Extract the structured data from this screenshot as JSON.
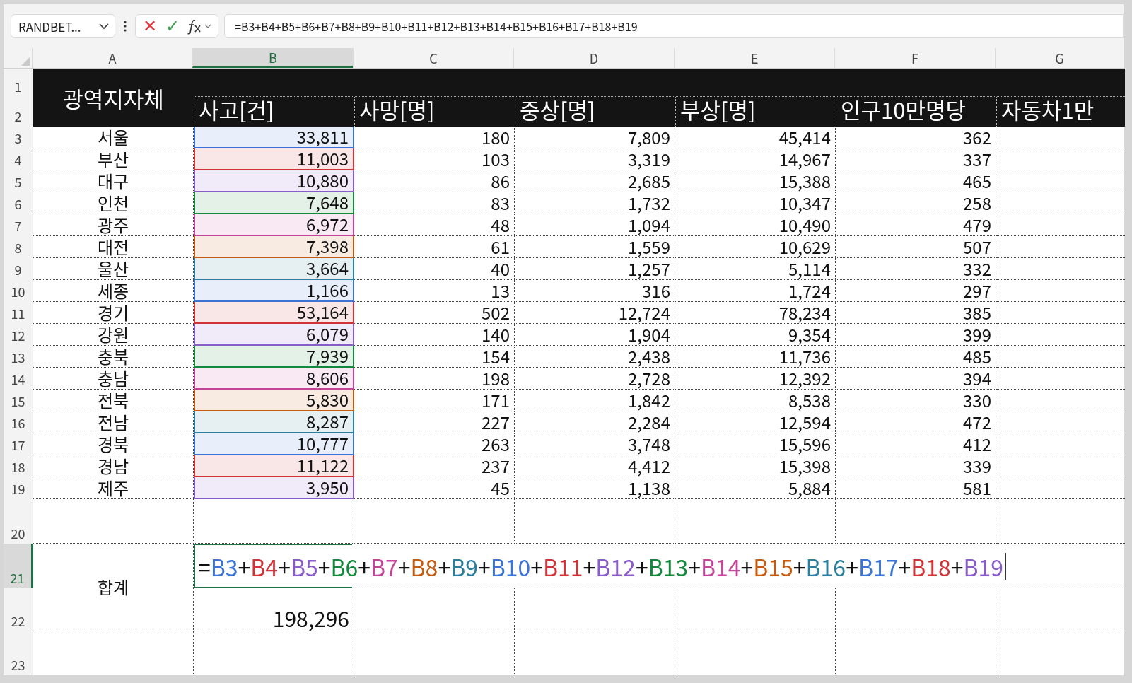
{
  "name_box": {
    "value": "RANDBET..."
  },
  "formula_bar": {
    "cancel_symbol": "✕",
    "enter_symbol": "✓",
    "value": "=B3+B4+B5+B6+B7+B8+B9+B10+B11+B12+B13+B14+B15+B16+B17+B18+B19"
  },
  "column_headers": [
    {
      "label": "A",
      "selected": false
    },
    {
      "label": "B",
      "selected": true
    },
    {
      "label": "C",
      "selected": false
    },
    {
      "label": "D",
      "selected": false
    },
    {
      "label": "E",
      "selected": false
    },
    {
      "label": "F",
      "selected": false
    },
    {
      "label": "G",
      "selected": false
    }
  ],
  "header": {
    "row_headers": [
      {
        "label": "1",
        "selected": false
      },
      {
        "label": "2",
        "selected": false
      }
    ],
    "region_label": "광역지자체",
    "columns": [
      "사고[건]",
      "사망[명]",
      "중상[명]",
      "부상[명]",
      "인구10만명당",
      "자동차1만"
    ]
  },
  "rows": [
    {
      "row_header": {
        "label": "3",
        "selected": false
      },
      "region": "서울",
      "accidents": "33,811",
      "deaths": "180",
      "serious": "7,809",
      "injuries": "45,414",
      "per_100k": "362",
      "color": "#3c74d6"
    },
    {
      "row_header": {
        "label": "4",
        "selected": false
      },
      "region": "부산",
      "accidents": "11,003",
      "deaths": "103",
      "serious": "3,319",
      "injuries": "14,967",
      "per_100k": "337",
      "color": "#d13438"
    },
    {
      "row_header": {
        "label": "5",
        "selected": false
      },
      "region": "대구",
      "accidents": "10,880",
      "deaths": "86",
      "serious": "2,685",
      "injuries": "15,388",
      "per_100k": "465",
      "color": "#8a5cc9"
    },
    {
      "row_header": {
        "label": "6",
        "selected": false
      },
      "region": "인천",
      "accidents": "7,648",
      "deaths": "83",
      "serious": "1,732",
      "injuries": "10,347",
      "per_100k": "258",
      "color": "#13893b"
    },
    {
      "row_header": {
        "label": "7",
        "selected": false
      },
      "region": "광주",
      "accidents": "6,972",
      "deaths": "48",
      "serious": "1,094",
      "injuries": "10,490",
      "per_100k": "479",
      "color": "#c2459a"
    },
    {
      "row_header": {
        "label": "8",
        "selected": false
      },
      "region": "대전",
      "accidents": "7,398",
      "deaths": "61",
      "serious": "1,559",
      "injuries": "10,629",
      "per_100k": "507",
      "color": "#c55a11"
    },
    {
      "row_header": {
        "label": "9",
        "selected": false
      },
      "region": "울산",
      "accidents": "3,664",
      "deaths": "40",
      "serious": "1,257",
      "injuries": "5,114",
      "per_100k": "332",
      "color": "#2b7e9d"
    },
    {
      "row_header": {
        "label": "10",
        "selected": false
      },
      "region": "세종",
      "accidents": "1,166",
      "deaths": "13",
      "serious": "316",
      "injuries": "1,724",
      "per_100k": "297",
      "color": "#3c74d6"
    },
    {
      "row_header": {
        "label": "11",
        "selected": false
      },
      "region": "경기",
      "accidents": "53,164",
      "deaths": "502",
      "serious": "12,724",
      "injuries": "78,234",
      "per_100k": "385",
      "color": "#d13438"
    },
    {
      "row_header": {
        "label": "12",
        "selected": false
      },
      "region": "강원",
      "accidents": "6,079",
      "deaths": "140",
      "serious": "1,904",
      "injuries": "9,354",
      "per_100k": "399",
      "color": "#8a5cc9"
    },
    {
      "row_header": {
        "label": "13",
        "selected": false
      },
      "region": "충북",
      "accidents": "7,939",
      "deaths": "154",
      "serious": "2,438",
      "injuries": "11,736",
      "per_100k": "485",
      "color": "#13893b"
    },
    {
      "row_header": {
        "label": "14",
        "selected": false
      },
      "region": "충남",
      "accidents": "8,606",
      "deaths": "198",
      "serious": "2,728",
      "injuries": "12,392",
      "per_100k": "394",
      "color": "#c2459a"
    },
    {
      "row_header": {
        "label": "15",
        "selected": false
      },
      "region": "전북",
      "accidents": "5,830",
      "deaths": "171",
      "serious": "1,842",
      "injuries": "8,538",
      "per_100k": "330",
      "color": "#c55a11"
    },
    {
      "row_header": {
        "label": "16",
        "selected": false
      },
      "region": "전남",
      "accidents": "8,287",
      "deaths": "227",
      "serious": "2,284",
      "injuries": "12,594",
      "per_100k": "472",
      "color": "#2b7e9d"
    },
    {
      "row_header": {
        "label": "17",
        "selected": false
      },
      "region": "경북",
      "accidents": "10,777",
      "deaths": "263",
      "serious": "3,748",
      "injuries": "15,596",
      "per_100k": "412",
      "color": "#3c74d6"
    },
    {
      "row_header": {
        "label": "18",
        "selected": false
      },
      "region": "경남",
      "accidents": "11,122",
      "deaths": "237",
      "serious": "4,412",
      "injuries": "15,398",
      "per_100k": "339",
      "color": "#d13438"
    },
    {
      "row_header": {
        "label": "19",
        "selected": false
      },
      "region": "제주",
      "accidents": "3,950",
      "deaths": "45",
      "serious": "1,138",
      "injuries": "5,884",
      "per_100k": "581",
      "color": "#8a5cc9"
    }
  ],
  "blank_row": {
    "row_header": {
      "label": "20",
      "selected": false
    }
  },
  "total": {
    "row_headers": [
      {
        "label": "21",
        "selected": true
      },
      {
        "label": "22",
        "selected": false
      }
    ],
    "label": "합계",
    "value": "198,296",
    "tokens": [
      {
        "kind": "op",
        "text": "="
      },
      {
        "kind": "ref",
        "text": "B3",
        "color": "#3c74d6"
      },
      {
        "kind": "op",
        "text": "+"
      },
      {
        "kind": "ref",
        "text": "B4",
        "color": "#d13438"
      },
      {
        "kind": "op",
        "text": "+"
      },
      {
        "kind": "ref",
        "text": "B5",
        "color": "#8a5cc9"
      },
      {
        "kind": "op",
        "text": "+"
      },
      {
        "kind": "ref",
        "text": "B6",
        "color": "#13893b"
      },
      {
        "kind": "op",
        "text": "+"
      },
      {
        "kind": "ref",
        "text": "B7",
        "color": "#c2459a"
      },
      {
        "kind": "op",
        "text": "+"
      },
      {
        "kind": "ref",
        "text": "B8",
        "color": "#c55a11"
      },
      {
        "kind": "op",
        "text": "+"
      },
      {
        "kind": "ref",
        "text": "B9",
        "color": "#2b7e9d"
      },
      {
        "kind": "op",
        "text": "+"
      },
      {
        "kind": "ref",
        "text": "B10",
        "color": "#3c74d6"
      },
      {
        "kind": "op",
        "text": "+"
      },
      {
        "kind": "ref",
        "text": "B11",
        "color": "#d13438"
      },
      {
        "kind": "op",
        "text": "+"
      },
      {
        "kind": "ref",
        "text": "B12",
        "color": "#8a5cc9"
      },
      {
        "kind": "op",
        "text": "+"
      },
      {
        "kind": "ref",
        "text": "B13",
        "color": "#13893b"
      },
      {
        "kind": "op",
        "text": "+"
      },
      {
        "kind": "ref",
        "text": "B14",
        "color": "#c2459a"
      },
      {
        "kind": "op",
        "text": "+"
      },
      {
        "kind": "ref",
        "text": "B15",
        "color": "#c55a11"
      },
      {
        "kind": "op",
        "text": "+"
      },
      {
        "kind": "ref",
        "text": "B16",
        "color": "#2b7e9d"
      },
      {
        "kind": "op",
        "text": "+"
      },
      {
        "kind": "ref",
        "text": "B17",
        "color": "#3c74d6"
      },
      {
        "kind": "op",
        "text": "+"
      },
      {
        "kind": "ref",
        "text": "B18",
        "color": "#d13438"
      },
      {
        "kind": "op",
        "text": "+"
      },
      {
        "kind": "ref",
        "text": "B19",
        "color": "#8a5cc9"
      }
    ]
  },
  "last_row": {
    "row_header": {
      "label": "23",
      "selected": false
    }
  }
}
